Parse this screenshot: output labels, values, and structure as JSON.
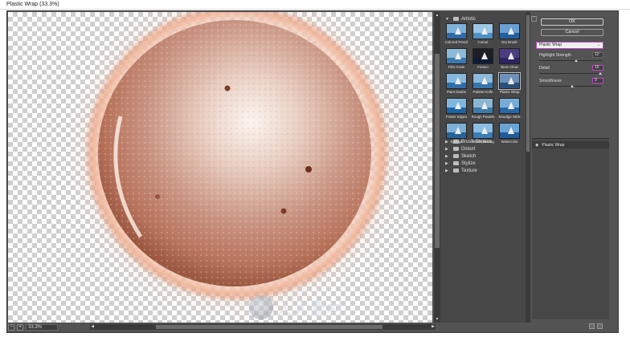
{
  "window": {
    "title": "Plastic Wrap (33.3%)"
  },
  "preview": {
    "zoom": "33.3%",
    "zoom_out": "−",
    "zoom_in": "+"
  },
  "gallery": {
    "folder_artistic": "Artistic",
    "thumbs": [
      {
        "label": "Colored Pencil",
        "sky": "#7fb0d8",
        "sea": "#2f6aa8"
      },
      {
        "label": "Cutout",
        "sky": "#9cc7e6",
        "sea": "#4e8fc4"
      },
      {
        "label": "Dry Brush",
        "sky": "#6a9fd1",
        "sea": "#225f9e"
      },
      {
        "label": "Film Grain",
        "sky": "#8bbad8",
        "sea": "#3a78ad"
      },
      {
        "label": "Fresco",
        "sky": "#1e1e26",
        "sea": "#0f1c36"
      },
      {
        "label": "Neon Glow",
        "sky": "#4a3e7e",
        "sea": "#2d2560"
      },
      {
        "label": "Paint Daubs",
        "sky": "#86b8df",
        "sea": "#2f6eab"
      },
      {
        "label": "Palette Knife",
        "sky": "#8cb9dc",
        "sea": "#3575af"
      },
      {
        "label": "Plastic Wrap",
        "sky": "#6c90b9",
        "sea": "#2b4f7a"
      },
      {
        "label": "Poster Edges",
        "sky": "#7fb6e0",
        "sea": "#1f63a5"
      },
      {
        "label": "Rough Pastels",
        "sky": "#8ab6d4",
        "sea": "#3d7aa7"
      },
      {
        "label": "Smudge Stick",
        "sky": "#78acd6",
        "sea": "#2a68a4"
      },
      {
        "label": "Sponge",
        "sky": "#7cb0d6",
        "sea": "#26629c"
      },
      {
        "label": "Underpainting",
        "sky": "#8abfe3",
        "sea": "#3b7db8"
      },
      {
        "label": "Watercolor",
        "sky": "#6aa4d4",
        "sea": "#1e5b98"
      }
    ],
    "folders": [
      {
        "label": "Brush Strokes"
      },
      {
        "label": "Distort"
      },
      {
        "label": "Sketch"
      },
      {
        "label": "Stylize"
      },
      {
        "label": "Texture"
      }
    ]
  },
  "settings": {
    "ok_label": "OK",
    "cancel_label": "Cancel",
    "filter_selected": "Plastic Wrap",
    "params": [
      {
        "label": "Highlight Strength",
        "value": "12",
        "level": 0.6
      },
      {
        "label": "Detail",
        "value": "15",
        "level": 1.0
      },
      {
        "label": "Smoothness",
        "value": "9",
        "level": 0.53
      }
    ],
    "layer_name": "Plastic Wrap"
  },
  "watermark": {
    "text": "人人素材"
  }
}
